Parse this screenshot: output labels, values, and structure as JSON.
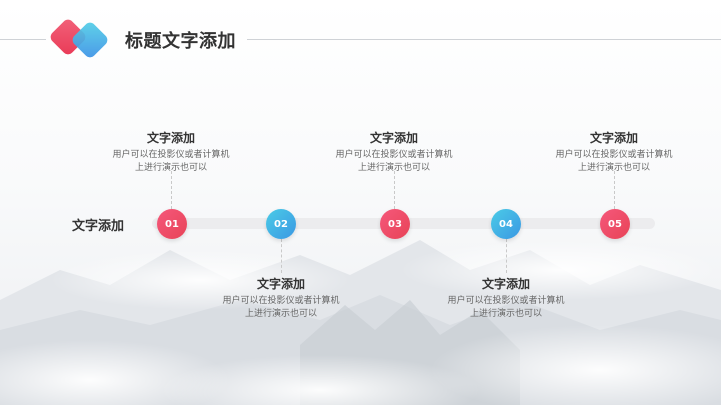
{
  "header": {
    "title": "标题文字添加"
  },
  "timeline": {
    "row_label": "文字添加",
    "nodes": [
      {
        "number": "01",
        "heading": "文字添加",
        "line1": "用户可以在投影仪或者计算机",
        "line2": "上进行演示也可以",
        "position": "above"
      },
      {
        "number": "02",
        "heading": "文字添加",
        "line1": "用户可以在投影仪或者计算机",
        "line2": "上进行演示也可以",
        "position": "below"
      },
      {
        "number": "03",
        "heading": "文字添加",
        "line1": "用户可以在投影仪或者计算机",
        "line2": "上进行演示也可以",
        "position": "above"
      },
      {
        "number": "04",
        "heading": "文字添加",
        "line1": "用户可以在投影仪或者计算机",
        "line2": "上进行演示也可以",
        "position": "below"
      },
      {
        "number": "05",
        "heading": "文字添加",
        "line1": "用户可以在投影仪或者计算机",
        "line2": "上进行演示也可以",
        "position": "above"
      }
    ]
  },
  "colors": {
    "red_accent": "#ee4d66",
    "blue_accent": "#45b6e6",
    "title_text": "#333333",
    "body_text": "#666666"
  }
}
